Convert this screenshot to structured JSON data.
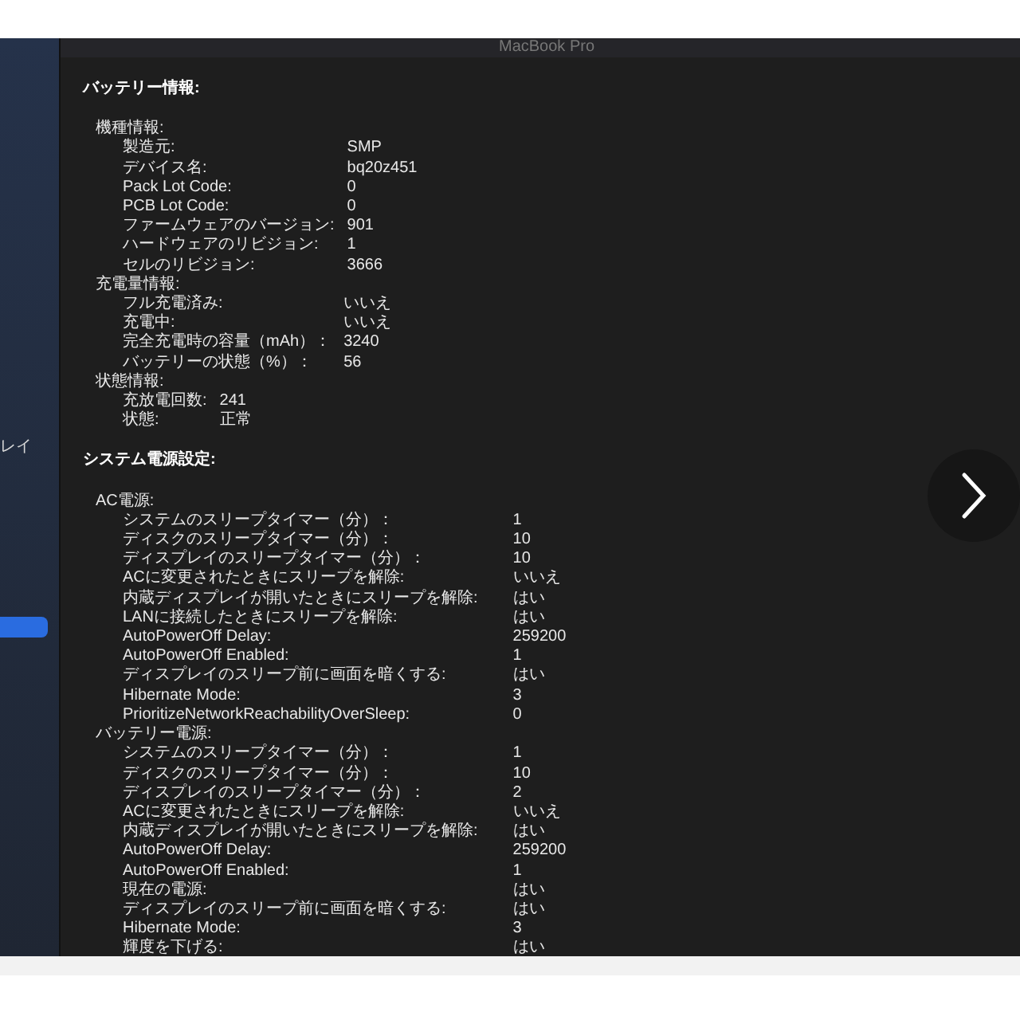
{
  "sidebar": {
    "items": [
      {
        "label": "レイ",
        "selected": false
      },
      {
        "selected": true
      }
    ]
  },
  "window": {
    "title": "MacBook Pro"
  },
  "sections": [
    {
      "title": "バッテリー情報:",
      "groups": [
        {
          "title": "機種情報:",
          "rows": [
            {
              "label": "製造元:",
              "value": "SMP"
            },
            {
              "label": "デバイス名:",
              "value": "bq20z451"
            },
            {
              "label": "Pack Lot Code:",
              "value": "0"
            },
            {
              "label": "PCB Lot Code:",
              "value": "0"
            },
            {
              "label": "ファームウェアのバージョン:",
              "value": "901"
            },
            {
              "label": "ハードウェアのリビジョン:",
              "value": "1"
            },
            {
              "label": "セルのリビジョン:",
              "value": "3666"
            }
          ]
        },
        {
          "title": "充電量情報:",
          "rows": [
            {
              "label": "フル充電済み:",
              "value": "いいえ"
            },
            {
              "label": "充電中:",
              "value": "いいえ"
            },
            {
              "label": "完全充電時の容量（mAh）：",
              "value": "3240"
            },
            {
              "label": "バッテリーの状態（%）：",
              "value": "56"
            }
          ]
        },
        {
          "title": "状態情報:",
          "rows": [
            {
              "label": "充放電回数:",
              "value": "241"
            },
            {
              "label": "状態:",
              "value": "正常"
            }
          ]
        }
      ]
    },
    {
      "title": "システム電源設定:",
      "groups": [
        {
          "title": "AC電源:",
          "rows": [
            {
              "label": "システムのスリープタイマー（分）：",
              "value": "1"
            },
            {
              "label": "ディスクのスリープタイマー（分）：",
              "value": "10"
            },
            {
              "label": "ディスプレイのスリープタイマー（分）：",
              "value": "10"
            },
            {
              "label": "ACに変更されたときにスリープを解除:",
              "value": "いいえ"
            },
            {
              "label": "内蔵ディスプレイが開いたときにスリープを解除:",
              "value": "はい"
            },
            {
              "label": "LANに接続したときにスリープを解除:",
              "value": "はい"
            },
            {
              "label": "AutoPowerOff Delay:",
              "value": "259200"
            },
            {
              "label": "AutoPowerOff Enabled:",
              "value": "1"
            },
            {
              "label": "ディスプレイのスリープ前に画面を暗くする:",
              "value": "はい"
            },
            {
              "label": "Hibernate Mode:",
              "value": "3"
            },
            {
              "label": "PrioritizeNetworkReachabilityOverSleep:",
              "value": "0"
            }
          ]
        },
        {
          "title": "バッテリー電源:",
          "rows": [
            {
              "label": "システムのスリープタイマー（分）：",
              "value": "1"
            },
            {
              "label": "ディスクのスリープタイマー（分）：",
              "value": "10"
            },
            {
              "label": "ディスプレイのスリープタイマー（分）：",
              "value": "2"
            },
            {
              "label": "ACに変更されたときにスリープを解除:",
              "value": "いいえ"
            },
            {
              "label": "内蔵ディスプレイが開いたときにスリープを解除:",
              "value": "はい"
            },
            {
              "label": "AutoPowerOff Delay:",
              "value": "259200"
            },
            {
              "label": "AutoPowerOff Enabled:",
              "value": "1"
            },
            {
              "label": "現在の電源:",
              "value": "はい"
            },
            {
              "label": "ディスプレイのスリープ前に画面を暗くする:",
              "value": "はい"
            },
            {
              "label": "Hibernate Mode:",
              "value": "3"
            },
            {
              "label": "輝度を下げる:",
              "value": "はい"
            }
          ]
        }
      ]
    }
  ]
}
